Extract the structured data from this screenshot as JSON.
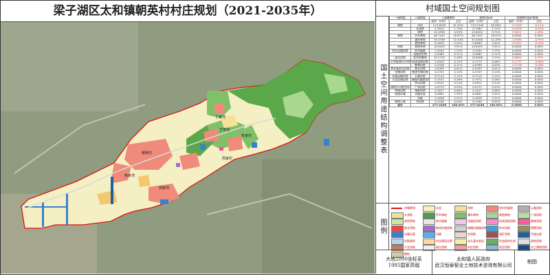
{
  "map": {
    "title": "梁子湖区太和镇朝英村村庄规划（2021-2035年）",
    "labels": [
      "丁家湾",
      "王家垅",
      "朱家村",
      "朝英村",
      "周家村",
      "熊家湾",
      "郭家湾"
    ]
  },
  "panel": {
    "title": "村域国土空间规划图",
    "table_side_label": "国土空间用途结构调整表",
    "legend_side_label": "图例"
  },
  "table": {
    "header1": [
      "一级地类",
      "二级地类",
      "三调基期年",
      "",
      "规划目标年",
      "",
      "规划期内面积增减"
    ],
    "header2": [
      "",
      "",
      "面积（公顷）",
      "占比",
      "面积（公顷）",
      "占比",
      "面积（公顷）",
      "占比"
    ],
    "rows": [
      [
        "耕地",
        "水田",
        "113.6245",
        "41.01%",
        "113.3140",
        "40.90%",
        "-0.3105",
        "-0.11%"
      ],
      [
        "",
        "水浇地",
        "4.7815",
        "1.73%",
        "4.7289",
        "1.71%",
        "-0.0526",
        "-0.02%"
      ],
      [
        "",
        "旱地",
        "12.5590",
        "4.53%",
        "15.8202",
        "5.71%",
        "3.2612",
        "1.18%"
      ],
      [
        "林地",
        "乔木林地",
        "46.7442",
        "16.87%",
        "46.7442",
        "16.87%",
        "0.0000",
        "0.00%"
      ],
      [
        "",
        "灌木林地",
        "34.4769",
        "12.44%",
        "31.8406",
        "11.49%",
        "-2.6363",
        "-0.95%"
      ],
      [
        "",
        "其他林地",
        "6.1610",
        "2.22%",
        "5.6083",
        "2.02%",
        "-0.5527",
        "-0.20%"
      ],
      [
        "草地",
        "其他草地",
        "10.8425",
        "3.91%",
        "10.8425",
        "3.91%",
        "0.0000",
        "0.00%"
      ],
      [
        "农业设施用地",
        "农村道路",
        "3.4184",
        "1.23%",
        "3.4184",
        "1.23%",
        "0.0000",
        "0.00%"
      ],
      [
        "",
        "设施农用地",
        "0.3085",
        "0.11%",
        "0.3085",
        "0.11%",
        "0.0000",
        "0.00%"
      ],
      [
        "居住用地",
        "农村宅基地",
        "15.1702",
        "5.48%",
        "15.8586",
        "5.72%",
        "0.6884",
        "0.25%"
      ],
      [
        "公共管理与公共服务用地",
        "机关团体用地",
        "0.3450",
        "0.12%",
        "0.1713",
        "0.06%",
        "-0.1737",
        "-0.06%"
      ],
      [
        "",
        "教育用地",
        "0.2928",
        "0.11%",
        "0.0789",
        "0.03%",
        "-0.2138",
        "-0.08%"
      ],
      [
        "商业服务业用地",
        "商业用地",
        "0.0395",
        "0.01%",
        "0.0395",
        "0.01%",
        "0.0000",
        "0.00%"
      ],
      [
        "仓储用地",
        "物流仓储用地",
        "0.2703",
        "0.10%",
        "0.2703",
        "0.10%",
        "0.0000",
        "0.00%"
      ],
      [
        "交通运输用地",
        "公路用地",
        "8.7210",
        "3.15%",
        "8.7210",
        "3.15%",
        "0.0000",
        "0.00%"
      ],
      [
        "公用设施用地",
        "城镇村道路用地",
        "0.7072",
        "0.26%",
        "0.7072",
        "0.26%",
        "0.0000",
        "0.00%"
      ],
      [
        "",
        "供水用地",
        "0.9522",
        "0.34%",
        "0.9522",
        "0.34%",
        "0.0000",
        "0.00%"
      ],
      [
        "绿地与开敞空间用地",
        "广场用地",
        "0.0723",
        "0.03%",
        "0.0723",
        "0.03%",
        "0.0000",
        "0.00%"
      ],
      [
        "特殊用地",
        "殡葬用地",
        "0.1617",
        "0.06%",
        "0.1617",
        "0.06%",
        "0.0000",
        "0.00%"
      ],
      [
        "陆地水域",
        "坑塘水面",
        "8.0861",
        "2.92%",
        "8.0861",
        "2.92%",
        "0.0000",
        "0.00%"
      ],
      [
        "",
        "沟渠",
        "9.1828",
        "3.31%",
        "9.1828",
        "3.31%",
        "0.0000",
        "0.00%"
      ],
      [
        "其他土地",
        "空闲地",
        "0.1160",
        "0.04%",
        "0.1160",
        "0.04%",
        "0.0000",
        "0.00%"
      ],
      [
        "总计",
        "",
        "277.0436",
        "100.00%",
        "277.0436",
        "100.00%",
        "0.0000",
        "0.00%"
      ]
    ]
  },
  "legend": [
    {
      "label": "村域界线",
      "color": "#ffffff",
      "line": "#d11"
    },
    {
      "label": "水田",
      "color": "#f6f2b8"
    },
    {
      "label": "旱地",
      "color": "#f5e29a"
    },
    {
      "label": "农村宅基地",
      "color": "#f08a7a"
    },
    {
      "label": "公路用地",
      "color": "#b0b0b0"
    },
    {
      "label": "水浇地",
      "color": "#e8e49a"
    },
    {
      "label": "乔木林地",
      "color": "#4aa04a"
    },
    {
      "label": "灌木林地",
      "color": "#7ec06a"
    },
    {
      "label": "其他林地",
      "color": "#a8d890"
    },
    {
      "label": "广场用地",
      "color": "#b8e0a0"
    },
    {
      "label": "其他草地",
      "color": "#c8e8a8"
    },
    {
      "label": "农村道路",
      "color": "#e8e8e8"
    },
    {
      "label": "设施农用地",
      "color": "#f0c8e8"
    },
    {
      "label": "机关团体用地",
      "color": "#ff88c8"
    },
    {
      "label": "教育用地",
      "color": "#ff5a9a"
    },
    {
      "label": "商业用地",
      "color": "#e84848"
    },
    {
      "label": "物流仓储用地",
      "color": "#a070c8"
    },
    {
      "label": "城镇村道路用地",
      "color": "#d0d0d0"
    },
    {
      "label": "供水用地",
      "color": "#40a0d8"
    },
    {
      "label": "殡葬用地",
      "color": "#909060"
    },
    {
      "label": "坑塘水面",
      "color": "#3a80d0"
    },
    {
      "label": "沟渠",
      "color": "#5ab0e8"
    },
    {
      "label": "空闲地",
      "color": "#e8d8c8"
    },
    {
      "label": "采矿用地",
      "color": "#a05050"
    },
    {
      "label": "河流水面",
      "color": "#2060a0"
    },
    {
      "label": "内陆滩涂",
      "color": "#b8d8e8"
    },
    {
      "label": "村庄建设边界",
      "color": "#ffd8a0"
    },
    {
      "label": "永久基本农田",
      "color": "#f8f0a0"
    },
    {
      "label": "生态保护红线",
      "color": "#68b068"
    },
    {
      "label": "其他用地",
      "color": "#e0e0e0"
    },
    {
      "label": "产业用地",
      "color": "#c08060"
    },
    {
      "label": "留白用地",
      "color": "#f0f0f0"
    },
    {
      "label": "村庄用地",
      "color": "#f0a0a0"
    },
    {
      "label": "渔业用地",
      "color": "#80c0d0"
    },
    {
      "label": "水工建筑用地",
      "color": "#1a4a8a"
    },
    {
      "label": "裸地",
      "color": "#d8c8a8"
    }
  ],
  "footer": {
    "left_line1": "大地2000坐标系",
    "left_line2": "1985国家高程",
    "mid_line1": "太和镇人民政府",
    "mid_line2": "武汉恒泰智业土地技术咨询有限公司",
    "right": "制图"
  }
}
